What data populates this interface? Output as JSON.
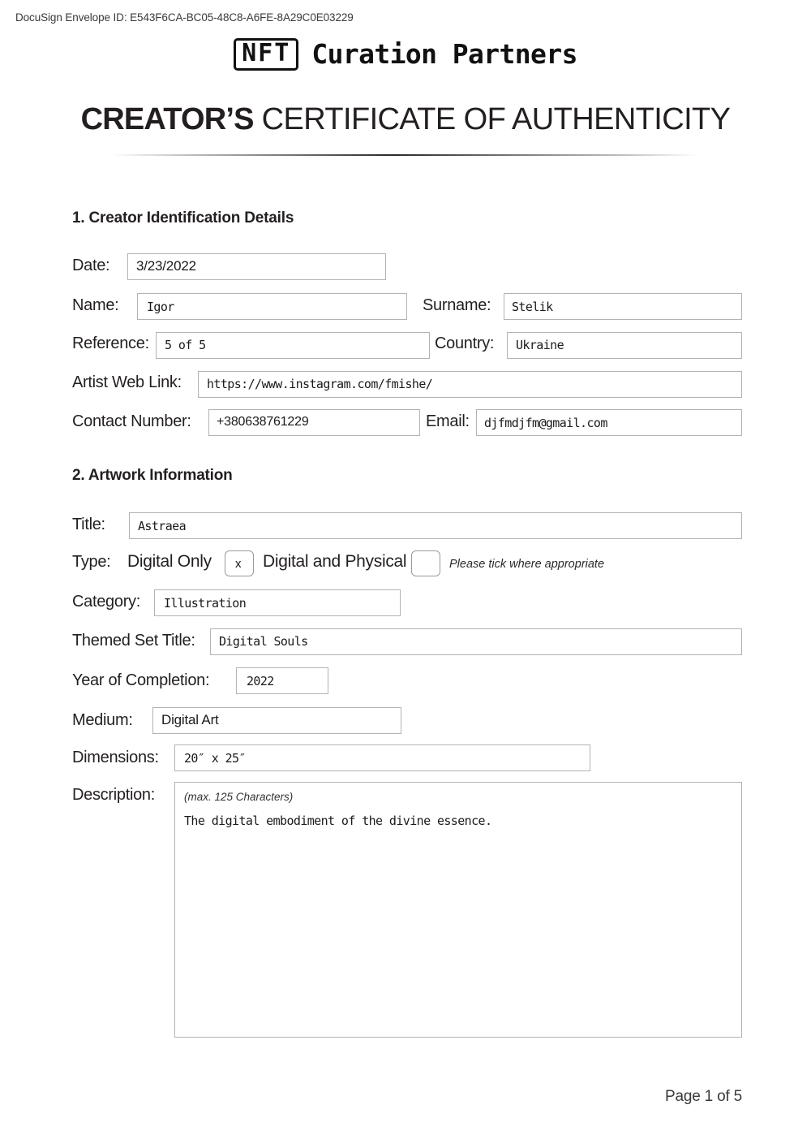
{
  "docusign": {
    "envelope_id_text": "DocuSign Envelope ID: E543F6CA-BC05-48C8-A6FE-8A29C0E03229"
  },
  "brand": {
    "badge": "NFT",
    "name": "Curation Partners"
  },
  "title": {
    "strong": "CREATOR’S",
    "light": "CERTIFICATE OF AUTHENTICITY"
  },
  "sections": {
    "one": {
      "heading": "1. Creator Identification Details",
      "fields": {
        "date": {
          "label": "Date:",
          "value": "3/23/2022"
        },
        "name": {
          "label": "Name:",
          "value": "Igor"
        },
        "surname": {
          "label": "Surname:",
          "value": "Stelik"
        },
        "reference": {
          "label": "Reference:",
          "value": "5 of 5"
        },
        "country": {
          "label": "Country:",
          "value": "Ukraine"
        },
        "web_link": {
          "label": "Artist Web Link:",
          "value": "https://www.instagram.com/fmishe/"
        },
        "contact": {
          "label": "Contact Number:",
          "value": "+380638761229"
        },
        "email": {
          "label": "Email:",
          "value": "djfmdjfm@gmail.com"
        }
      }
    },
    "two": {
      "heading": "2. Artwork Information",
      "fields": {
        "title": {
          "label": "Title:",
          "value": "Astraea"
        },
        "type": {
          "label": "Type:",
          "option_digital_only": "Digital Only",
          "option_digital_physical": "Digital and Physical",
          "digital_only_mark": "x",
          "digital_physical_mark": "",
          "note": "Please tick where appropriate"
        },
        "category": {
          "label": "Category:",
          "value": "Illustration"
        },
        "themed_set": {
          "label": "Themed Set Title:",
          "value": "Digital Souls"
        },
        "year": {
          "label": "Year of Completion:",
          "value": "2022"
        },
        "medium": {
          "label": "Medium:",
          "value": "Digital Art"
        },
        "dimensions": {
          "label": "Dimensions:",
          "value": "20″ x 25″"
        },
        "description": {
          "label": "Description:",
          "hint": "(max. 125 Characters)",
          "value": "The digital embodiment of the divine essence."
        }
      }
    }
  },
  "footer": {
    "page_label": "Page 1 of 5"
  },
  "colors": {
    "text": "#231f20",
    "box_border": "#b3b3b3",
    "tick_border": "#9a9a9a"
  }
}
